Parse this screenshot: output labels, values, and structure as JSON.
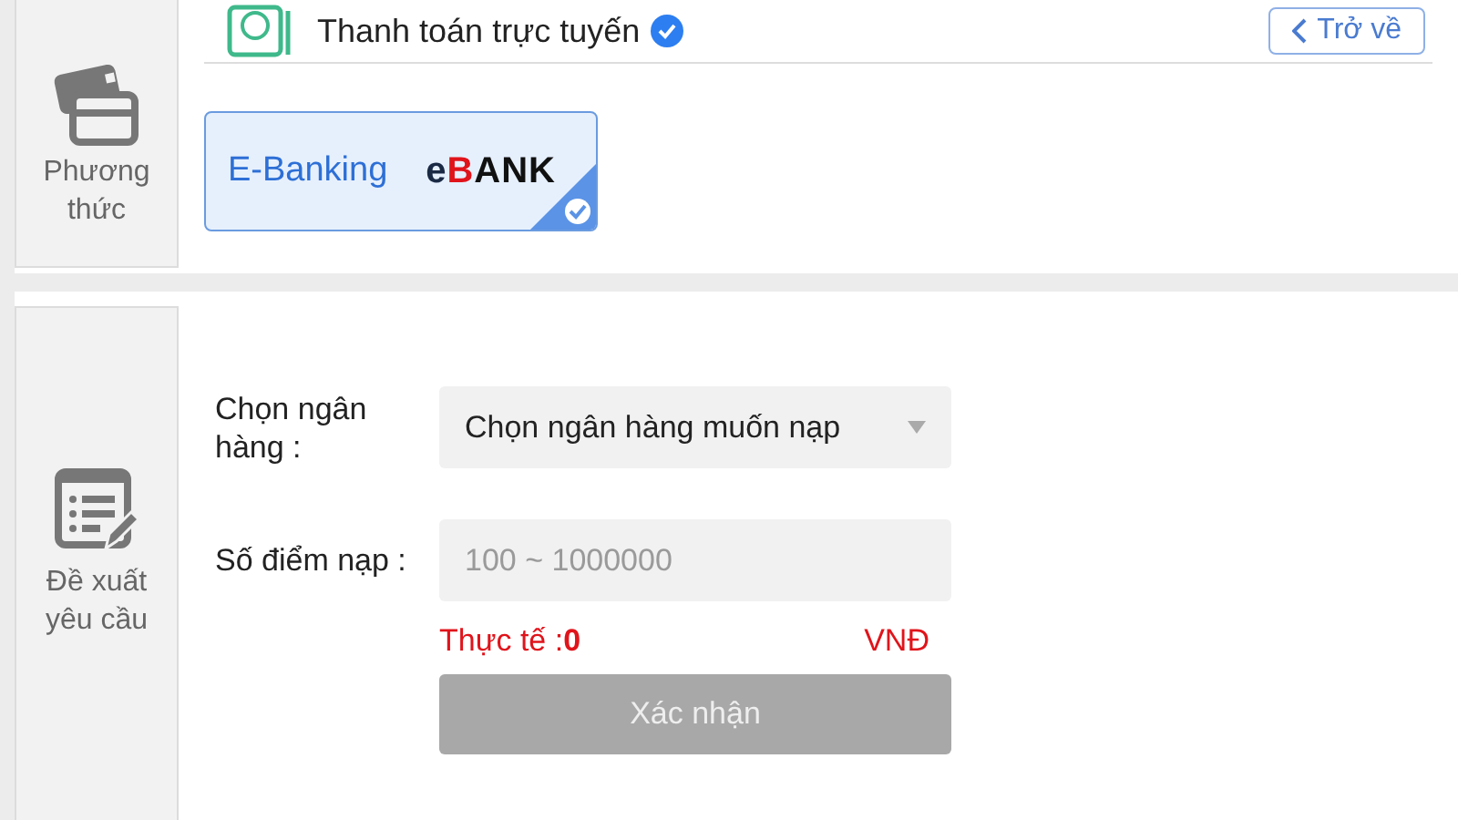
{
  "payment_section": {
    "sidebar_label": "Phương thức",
    "header_title": "Thanh toán trực tuyến",
    "back_button": "Trở về",
    "methods": [
      {
        "label": "E-Banking",
        "logo_prefix": "e",
        "logo_accent": "B",
        "logo_rest": "ANK",
        "selected": true
      }
    ]
  },
  "request_section": {
    "sidebar_label": "Đề xuất yêu cầu",
    "bank_field": {
      "label": "Chọn ngân hàng :",
      "value": "Chọn ngân hàng muốn nạp"
    },
    "amount_field": {
      "label": "Số điểm nạp :",
      "placeholder": "100 ~ 1000000"
    },
    "actual": "Thực tế :**0**",
    "currency": "VNĐ",
    "submit": {
      "label": "Xác nhận",
      "disabled": true
    }
  }
}
